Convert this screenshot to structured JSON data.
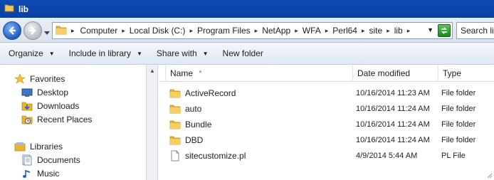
{
  "window": {
    "title": "lib"
  },
  "address": {
    "crumbs": [
      "Computer",
      "Local Disk (C:)",
      "Program Files",
      "NetApp",
      "WFA",
      "Perl64",
      "site",
      "lib"
    ]
  },
  "search": {
    "placeholder": "Search lib"
  },
  "toolbar": {
    "organize": "Organize",
    "include_in_library": "Include in library",
    "share_with": "Share with",
    "new_folder": "New folder"
  },
  "nav": {
    "favorites_heading": "Favorites",
    "favorites": [
      "Desktop",
      "Downloads",
      "Recent Places"
    ],
    "libraries_heading": "Libraries",
    "libraries": [
      "Documents",
      "Music"
    ]
  },
  "columns": {
    "name": "Name",
    "date": "Date modified",
    "type": "Type"
  },
  "files": [
    {
      "name": "ActiveRecord",
      "date": "10/16/2014 11:23 AM",
      "type": "File folder",
      "icon": "folder-icon"
    },
    {
      "name": "auto",
      "date": "10/16/2014 11:24 AM",
      "type": "File folder",
      "icon": "folder-icon"
    },
    {
      "name": "Bundle",
      "date": "10/16/2014 11:24 AM",
      "type": "File folder",
      "icon": "folder-icon"
    },
    {
      "name": "DBD",
      "date": "10/16/2014 11:24 AM",
      "type": "File folder",
      "icon": "folder-icon"
    },
    {
      "name": "sitecustomize.pl",
      "date": "4/9/2014 5:44 AM",
      "type": "PL File",
      "icon": "file-icon"
    }
  ],
  "colors": {
    "titlebar": "#0d4cb4",
    "folder": "#e8b531",
    "nav_back": "#1f5fc4"
  }
}
